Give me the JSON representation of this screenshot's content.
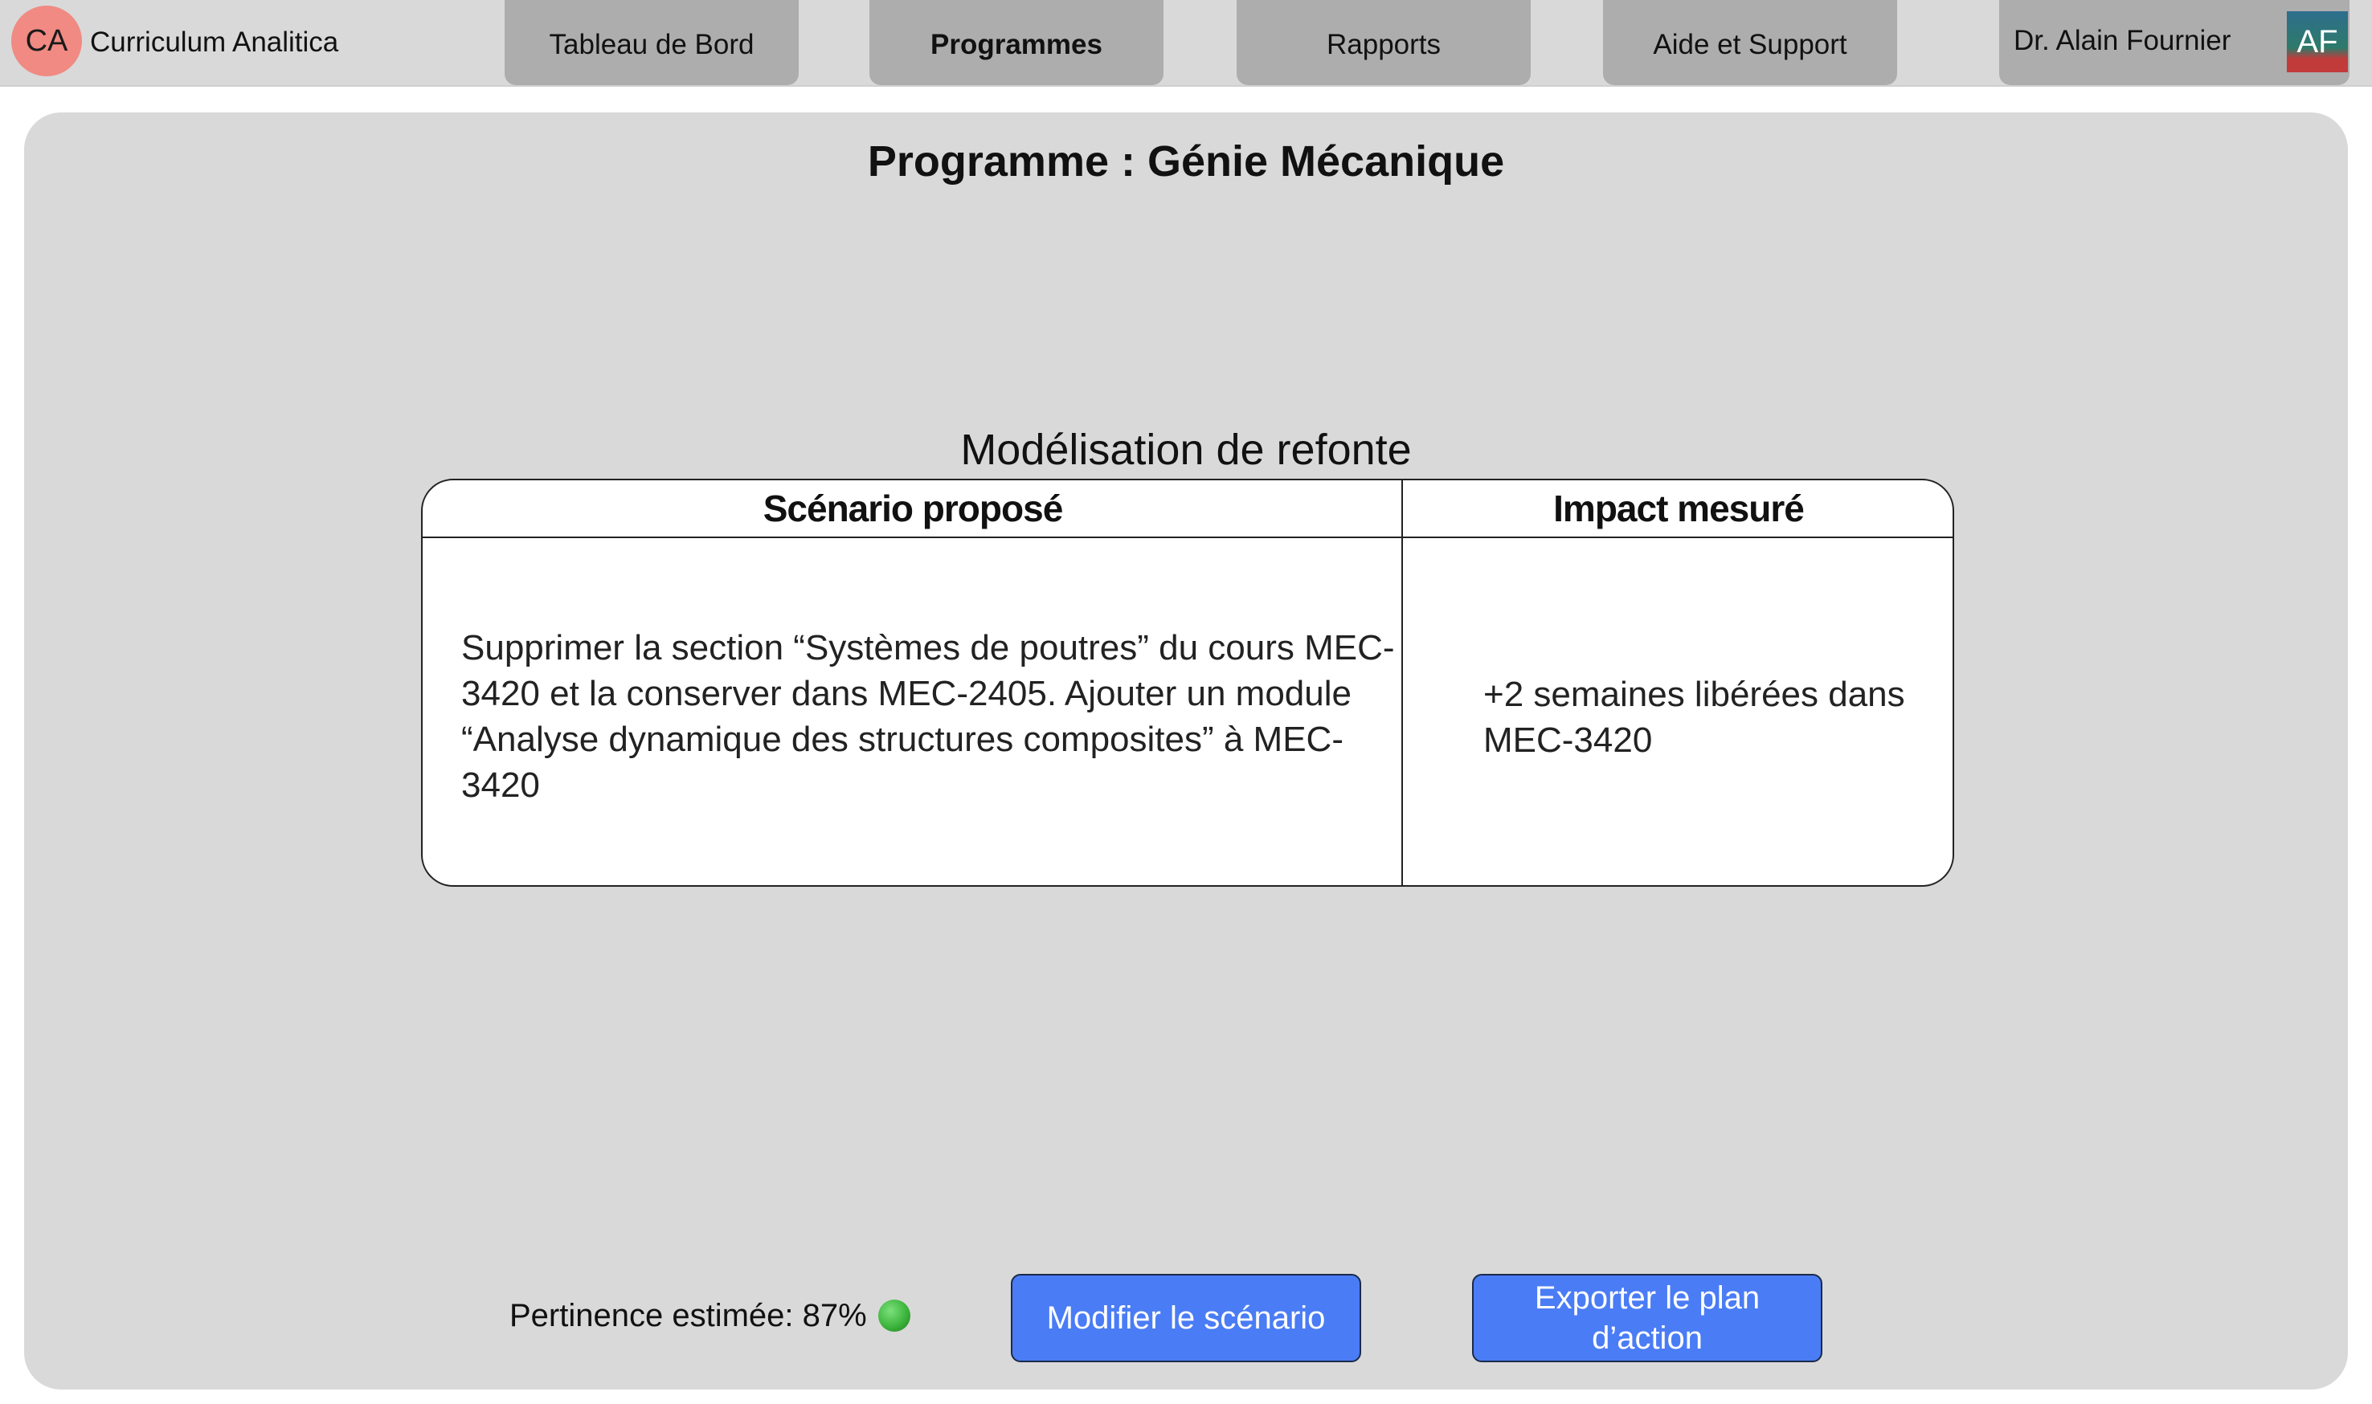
{
  "app": {
    "logo_initials": "CA",
    "name": "Curriculum Analitica"
  },
  "nav": {
    "tabs": [
      {
        "label": "Tableau de Bord",
        "active": false
      },
      {
        "label": "Programmes",
        "active": true
      },
      {
        "label": "Rapports",
        "active": false
      },
      {
        "label": "Aide et Support",
        "active": false
      }
    ]
  },
  "user": {
    "name": "Dr. Alain Fournier",
    "initials": "AF"
  },
  "main": {
    "title": "Programme : Génie Mécanique",
    "section_title": "Modélisation de refonte",
    "table": {
      "headers": [
        "Scénario proposé",
        "Impact mesuré"
      ],
      "rows": [
        {
          "scenario": "Supprimer la section “Systèmes de poutres” du cours MEC-3420 et la conserver dans MEC-2405. Ajouter un module “Analyse dynamique des structures composites” à MEC-3420",
          "impact": "+2 semaines libérées dans MEC-3420"
        }
      ]
    },
    "relevance": {
      "text": "Pertinence estimée: 87%",
      "status_icon": "green-circle-icon",
      "status_color": "#3db53d"
    },
    "buttons": {
      "modify_label": "Modifier le scénario",
      "export_label": "Exporter le plan d’action"
    }
  },
  "colors": {
    "topbar_bg": "#d9d9d9",
    "tab_bg": "#adadad",
    "panel_bg": "#d9d9d9",
    "logo_bg": "#f08a83",
    "button_bg": "#4a7cf5"
  }
}
